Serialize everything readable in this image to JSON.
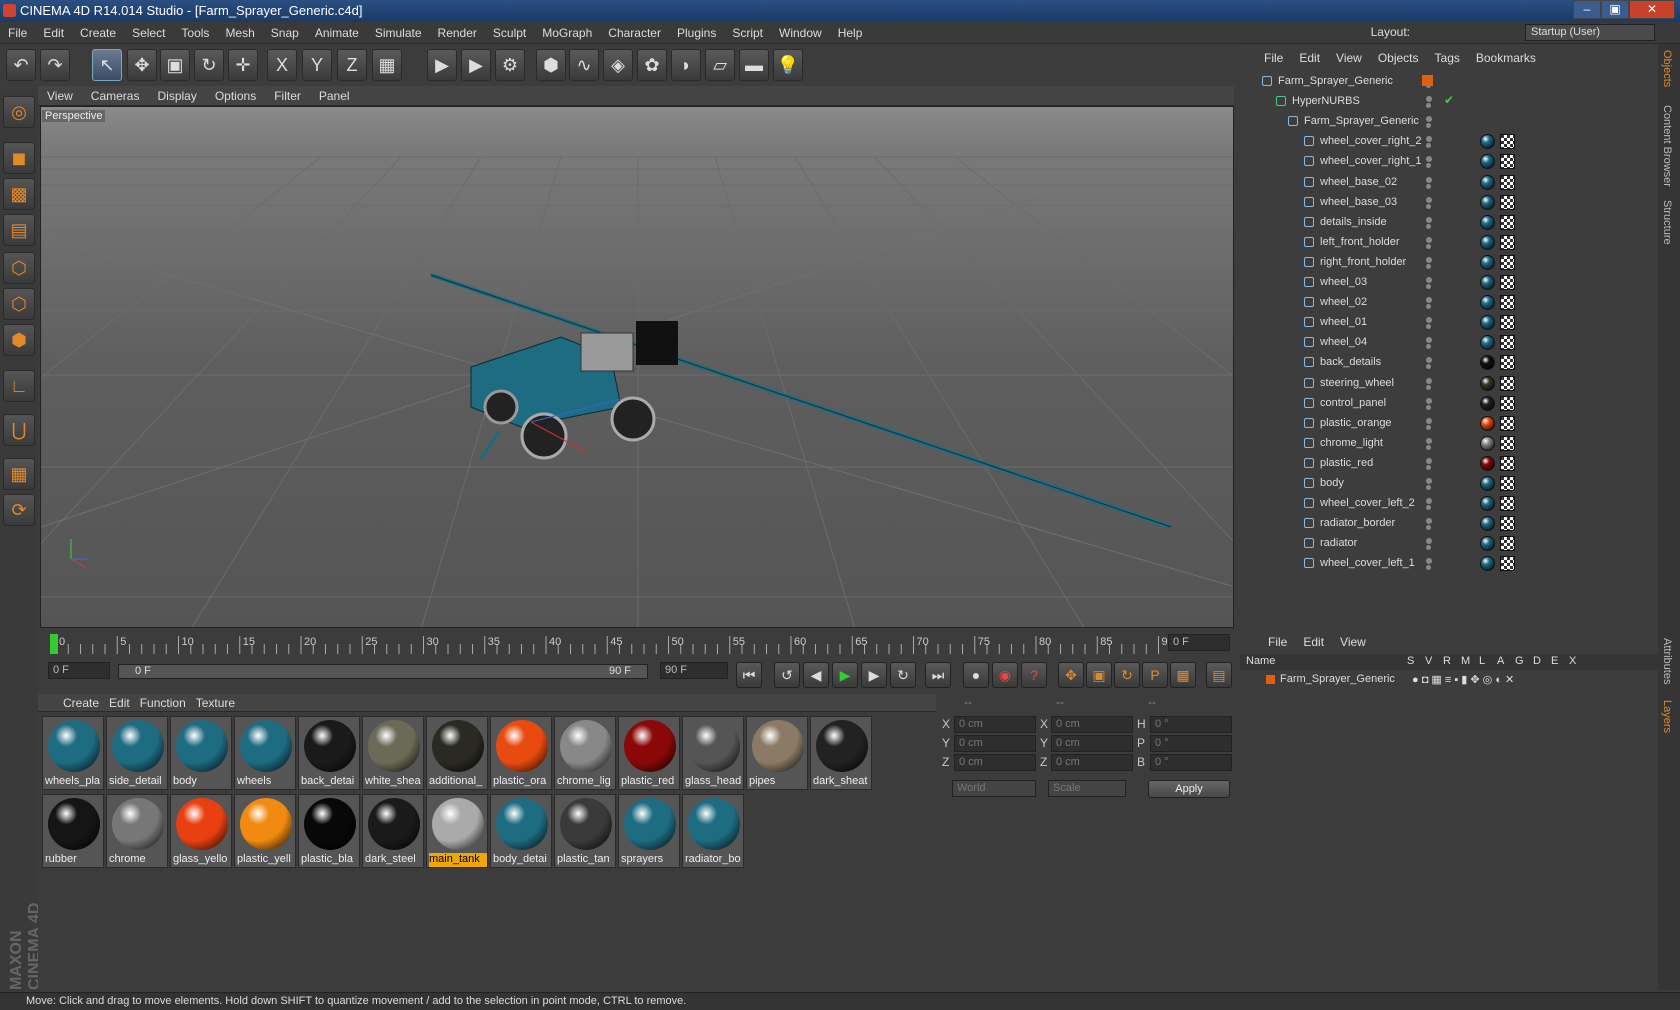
{
  "window": {
    "title": "CINEMA 4D R14.014 Studio - [Farm_Sprayer_Generic.c4d]",
    "min": "–",
    "max": "▣",
    "close": "✕"
  },
  "menubar": [
    "File",
    "Edit",
    "Create",
    "Select",
    "Tools",
    "Mesh",
    "Snap",
    "Animate",
    "Simulate",
    "Render",
    "Sculpt",
    "MoGraph",
    "Character",
    "Plugins",
    "Script",
    "Window",
    "Help"
  ],
  "layout": {
    "label": "Layout:",
    "value": "Startup (User)"
  },
  "toolbar_icons": [
    "undo-icon",
    "redo-icon",
    "select-arrow-icon",
    "move-icon",
    "scale-icon",
    "rotate-icon",
    "add-icon",
    "x-axis-icon",
    "y-axis-icon",
    "z-axis-icon",
    "coord-system-icon",
    "render-view-icon",
    "render-picture-viewer-icon",
    "render-settings-icon",
    "cube-primitive-icon",
    "spline-icon",
    "nurbs-icon",
    "array-icon",
    "deformer-icon",
    "floor-icon",
    "camera-icon",
    "light-icon"
  ],
  "toolbar_glyphs": [
    "↶",
    "↷",
    "↖",
    "✥",
    "▣",
    "↻",
    "✛",
    "X",
    "Y",
    "Z",
    "▦",
    "▶",
    "▶",
    "⚙",
    "⬢",
    "∿",
    "◈",
    "✿",
    "◗",
    "▱",
    "▬",
    "💡"
  ],
  "viewport": {
    "menu": [
      "View",
      "Cameras",
      "Display",
      "Options",
      "Filter",
      "Panel"
    ],
    "label": "Perspective"
  },
  "timeline": {
    "ticks": [
      "0",
      "5",
      "10",
      "15",
      "20",
      "25",
      "30",
      "35",
      "40",
      "45",
      "50",
      "55",
      "60",
      "65",
      "70",
      "75",
      "80",
      "85",
      "90"
    ],
    "current": "0 F",
    "start": "0 F",
    "range_start": "0 F",
    "range_end": "90 F",
    "end": "90 F"
  },
  "materials": {
    "menu": [
      "Create",
      "Edit",
      "Function",
      "Texture"
    ],
    "items": [
      {
        "name": "wheels_pla",
        "color": "#1e6c82"
      },
      {
        "name": "side_detail",
        "color": "#1e6c82"
      },
      {
        "name": "body",
        "color": "#1e6c82"
      },
      {
        "name": "wheels",
        "color": "#1e6c82"
      },
      {
        "name": "back_detai",
        "color": "#1a1a1a"
      },
      {
        "name": "white_shea",
        "color": "#6a6a56"
      },
      {
        "name": "additional_",
        "color": "#2a2a22"
      },
      {
        "name": "plastic_ora",
        "color": "#e84a10"
      },
      {
        "name": "chrome_lig",
        "color": "#888888"
      },
      {
        "name": "plastic_red",
        "color": "#8a0808"
      },
      {
        "name": "glass_head",
        "color": "#555555"
      },
      {
        "name": "pipes",
        "color": "#8a7a66"
      },
      {
        "name": "dark_sheat",
        "color": "#222222"
      },
      {
        "name": "rubber",
        "color": "#151515"
      },
      {
        "name": "chrome",
        "color": "#777777"
      },
      {
        "name": "glass_yello",
        "color": "#e84010"
      },
      {
        "name": "plastic_yell",
        "color": "#f08a10"
      },
      {
        "name": "plastic_bla",
        "color": "#080808"
      },
      {
        "name": "dark_steel",
        "color": "#1a1a1a"
      },
      {
        "name": "main_tank",
        "color": "#aaaaaa"
      },
      {
        "name": "body_detai",
        "color": "#1e6c82"
      },
      {
        "name": "plastic_tan",
        "color": "#3a3a3a"
      },
      {
        "name": "sprayers",
        "color": "#1e6c82"
      },
      {
        "name": "radiator_bo",
        "color": "#1e6c82"
      }
    ]
  },
  "coords": {
    "headers": [
      "--",
      "--",
      "--"
    ],
    "rows": [
      {
        "a": "X",
        "av": "0 cm",
        "b": "X",
        "bv": "0 cm",
        "c": "H",
        "cv": "0 °"
      },
      {
        "a": "Y",
        "av": "0 cm",
        "b": "Y",
        "bv": "0 cm",
        "c": "P",
        "cv": "0 °"
      },
      {
        "a": "Z",
        "av": "0 cm",
        "b": "Z",
        "bv": "0 cm",
        "c": "B",
        "cv": "0 °"
      }
    ],
    "mode1": "World",
    "mode2": "Scale",
    "apply": "Apply"
  },
  "objects": {
    "menu": [
      "File",
      "Edit",
      "View",
      "Objects",
      "Tags",
      "Bookmarks"
    ],
    "rows": [
      {
        "name": "Farm_Sprayer_Generic",
        "indent": 0,
        "type": "null"
      },
      {
        "name": "HyperNURBS",
        "indent": 1,
        "type": "nurbs"
      },
      {
        "name": "Farm_Sprayer_Generic",
        "indent": 2,
        "type": "null"
      },
      {
        "name": "wheel_cover_right_2",
        "indent": 3,
        "type": "poly",
        "tag": "#1e6c82"
      },
      {
        "name": "wheel_cover_right_1",
        "indent": 3,
        "type": "poly",
        "tag": "#1e6c82"
      },
      {
        "name": "wheel_base_02",
        "indent": 3,
        "type": "poly",
        "tag": "#1e6c82"
      },
      {
        "name": "wheel_base_03",
        "indent": 3,
        "type": "poly",
        "tag": "#1e6c82"
      },
      {
        "name": "details_inside",
        "indent": 3,
        "type": "poly",
        "tag": "#1e6c82"
      },
      {
        "name": "left_front_holder",
        "indent": 3,
        "type": "poly",
        "tag": "#1e6c82"
      },
      {
        "name": "right_front_holder",
        "indent": 3,
        "type": "poly",
        "tag": "#1e6c82"
      },
      {
        "name": "wheel_03",
        "indent": 3,
        "type": "poly",
        "tag": "#1e6c82"
      },
      {
        "name": "wheel_02",
        "indent": 3,
        "type": "poly",
        "tag": "#1e6c82"
      },
      {
        "name": "wheel_01",
        "indent": 3,
        "type": "poly",
        "tag": "#1e6c82"
      },
      {
        "name": "wheel_04",
        "indent": 3,
        "type": "poly",
        "tag": "#1e6c82"
      },
      {
        "name": "back_details",
        "indent": 3,
        "type": "poly",
        "tag": "#111111"
      },
      {
        "name": "steering_wheel",
        "indent": 3,
        "type": "poly",
        "tag": "#3a3a2a"
      },
      {
        "name": "control_panel",
        "indent": 3,
        "type": "poly",
        "tag": "#222222"
      },
      {
        "name": "plastic_orange",
        "indent": 3,
        "type": "poly",
        "tag": "#e84a10"
      },
      {
        "name": "chrome_light",
        "indent": 3,
        "type": "poly",
        "tag": "#888888"
      },
      {
        "name": "plastic_red",
        "indent": 3,
        "type": "poly",
        "tag": "#8a0808"
      },
      {
        "name": "body",
        "indent": 3,
        "type": "poly",
        "tag": "#1e6c82"
      },
      {
        "name": "wheel_cover_left_2",
        "indent": 3,
        "type": "poly",
        "tag": "#1e6c82"
      },
      {
        "name": "radiator_border",
        "indent": 3,
        "type": "poly",
        "tag": "#1e6c82"
      },
      {
        "name": "radiator",
        "indent": 3,
        "type": "poly",
        "tag": "#1e6c82"
      },
      {
        "name": "wheel_cover_left_1",
        "indent": 3,
        "type": "poly",
        "tag": "#1e6c82"
      }
    ]
  },
  "layers": {
    "menu": [
      "File",
      "Edit",
      "View"
    ],
    "columns": [
      "Name",
      "S",
      "V",
      "R",
      "M",
      "L",
      "A",
      "G",
      "D",
      "E",
      "X"
    ],
    "row": "Farm_Sprayer_Generic"
  },
  "side_tabs": [
    "Objects",
    "Content Browser",
    "Structure",
    "Attributes",
    "Layers"
  ],
  "brand": "MAXON CINEMA 4D",
  "status": "Move: Click and drag to move elements. Hold down SHIFT to quantize movement / add to the selection in point mode, CTRL to remove."
}
